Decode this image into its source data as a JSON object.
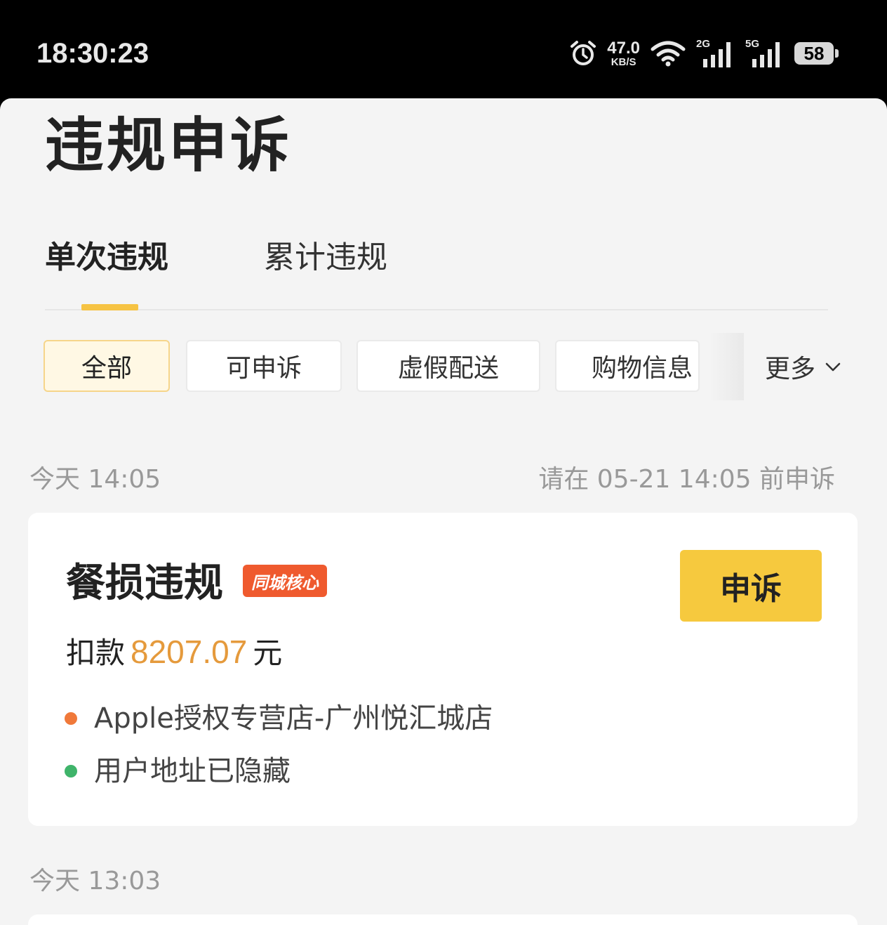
{
  "status_bar": {
    "time": "18:30:23",
    "net_speed_value": "47.0",
    "net_speed_unit": "KB/S",
    "sim1_label": "2G",
    "sim2_label": "5G",
    "battery": "58"
  },
  "page": {
    "title": "违规申诉"
  },
  "tabs": [
    {
      "label": "单次违规",
      "active": true
    },
    {
      "label": "累计违规",
      "active": false
    }
  ],
  "filters": {
    "chips": [
      "全部",
      "可申诉",
      "虚假配送",
      "购物信息"
    ],
    "active_index": 0,
    "more_label": "更多"
  },
  "records": [
    {
      "time": "今天 14:05",
      "deadline": "请在 05-21 14:05 前申诉",
      "title": "餐损违规",
      "badge": "同城核心",
      "action_label": "申诉",
      "deduct_prefix": "扣款",
      "amount": "8207.07",
      "unit": "元",
      "store": "Apple授权专营店-广州悦汇城店",
      "address": "用户地址已隐藏",
      "colors": {
        "store_dot": "#f0793a",
        "address_dot": "#3fb46a",
        "amount": "#e59a3c",
        "badge": "#ef5a2e",
        "button": "#f6c93e"
      }
    },
    {
      "time": "今天 13:03"
    }
  ]
}
